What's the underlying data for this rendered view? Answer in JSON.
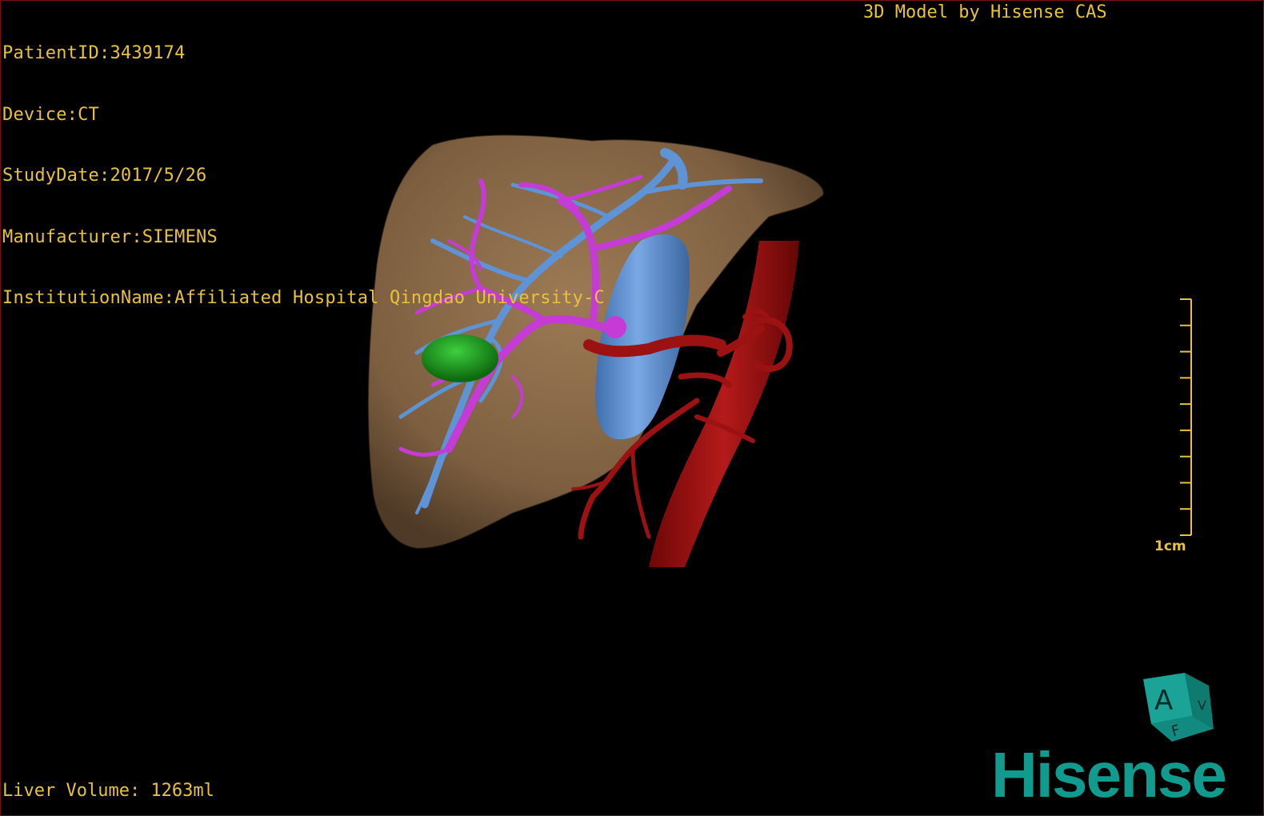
{
  "overlay_color": "#e8c23a",
  "patient_info": {
    "patient_id": "PatientID:3439174",
    "device": "Device:CT",
    "study_date": "StudyDate:2017/5/26",
    "manufacturer": "Manufacturer:SIEMENS",
    "institution": "InstitutionName:Affiliated Hospital Qingdao University-C"
  },
  "credit": "3D Model by Hisense CAS",
  "liver_volume": "Liver Volume: 1263ml",
  "scale_bar": {
    "label": "1cm"
  },
  "orientation_cube": {
    "front_label": "A",
    "side_label": "V",
    "bottom_label": "F",
    "color": "#1aa396"
  },
  "brand": {
    "name": "Hisense",
    "color": "#119a8e"
  },
  "structures": {
    "liver": {
      "color": "#8a6a48"
    },
    "portal_vein": {
      "color": "#c43bd6"
    },
    "hepatic_vein_ivc": {
      "color": "#5e93d6"
    },
    "aorta_arteries": {
      "color": "#9c1111"
    },
    "gallbladder_lesion": {
      "color": "#1f9a1f"
    }
  }
}
